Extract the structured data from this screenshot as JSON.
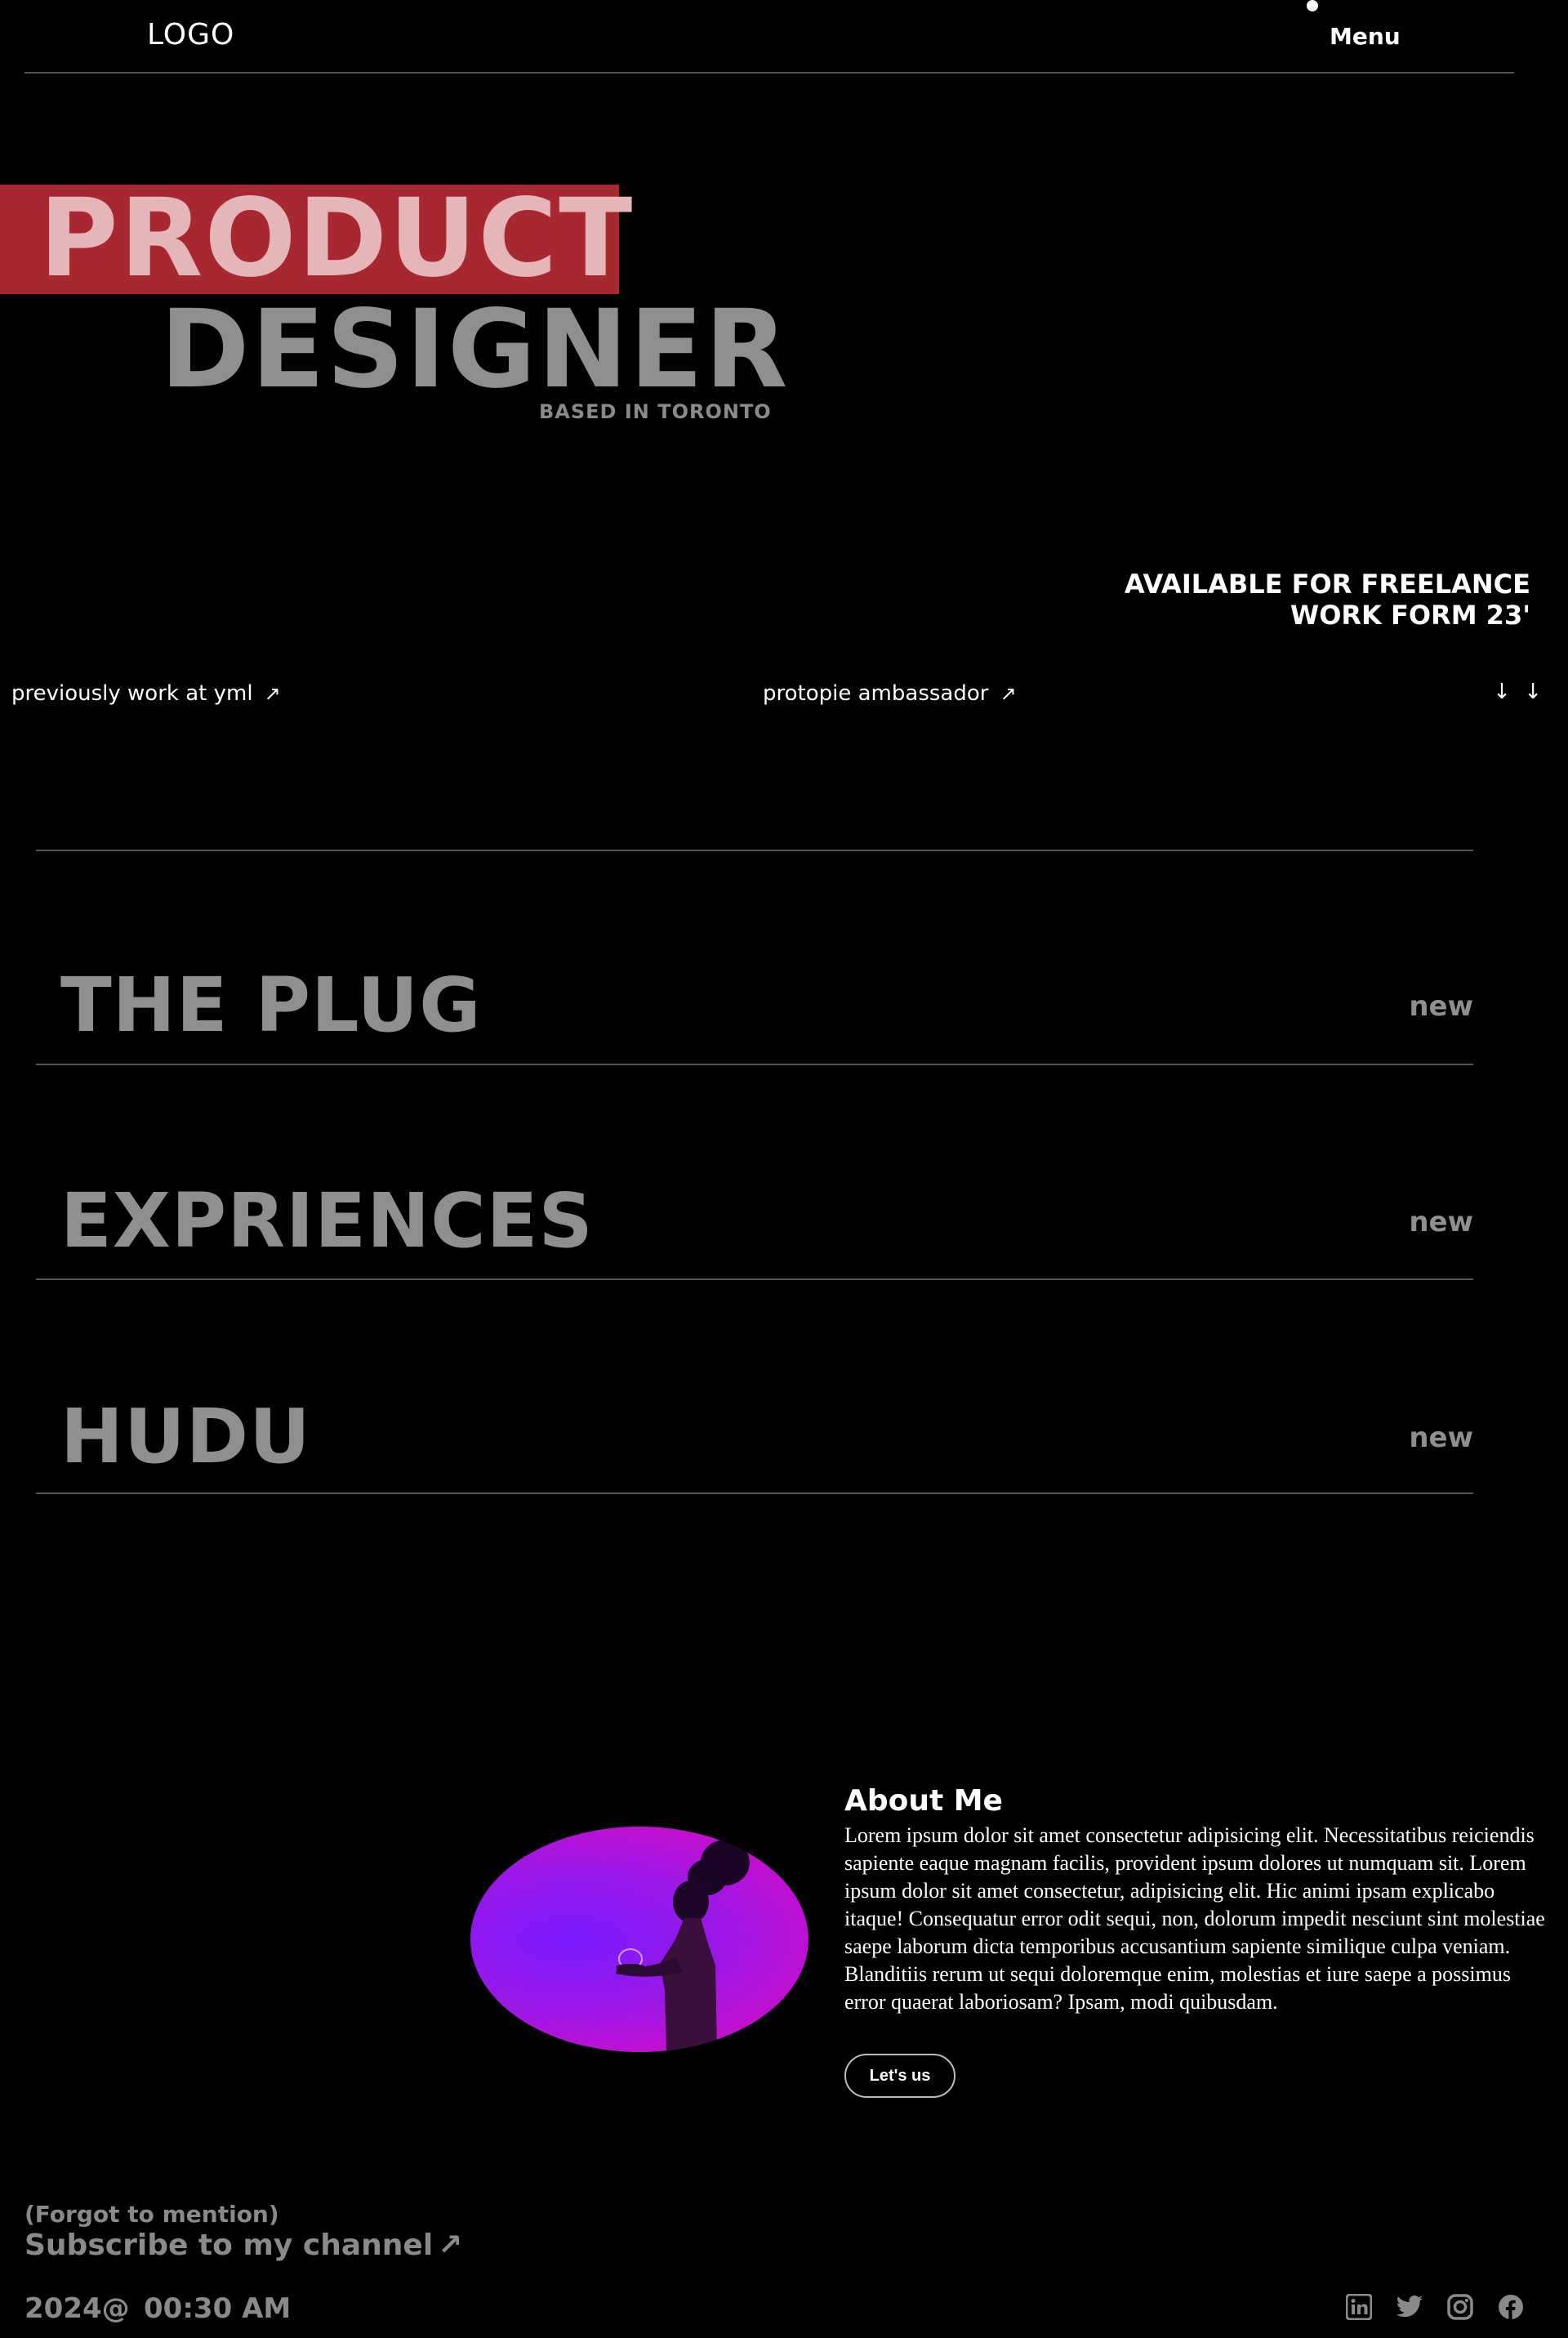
{
  "header": {
    "logo": "LOGO",
    "menu_label": "Menu"
  },
  "hero": {
    "line1": "PRODUCT",
    "line2": "DESIGNER",
    "location": "BASED IN TORONTO",
    "highlight_color": "#a8282f"
  },
  "availability": {
    "line1": "AVAILABLE FOR FREELANCE",
    "line2": "WORK FORM 23'"
  },
  "links": [
    {
      "label": "previously work at yml",
      "icon": "arrow-up-right-icon"
    },
    {
      "label": "protopie ambassador",
      "icon": "arrow-up-right-icon"
    }
  ],
  "scroll_hint": "↓ ↓",
  "projects": [
    {
      "title": "THE PLUG",
      "badge": "new"
    },
    {
      "title": "EXPRIENCES",
      "badge": "new"
    },
    {
      "title": "HUDU",
      "badge": "new"
    }
  ],
  "about": {
    "title": "About Me",
    "body": "Lorem ipsum dolor sit amet consectetur adipisicing elit. Necessitatibus reiciendis sapiente eaque magnam facilis, provident ipsum dolores ut numquam sit. Lorem ipsum dolor sit amet consectetur, adipisicing elit. Hic animi ipsam explicabo itaque! Consequatur error odit sequi, non, dolorum impedit nesciunt sint molestiae saepe laborum dicta temporibus accusantium sapiente similique culpa veniam. Blanditiis rerum ut sequi doloremque enim, molestias et iure saepe a possimus error quaerat laboriosam? Ipsam, modi quibusdam.",
    "button_label": "Let's us",
    "image_icon": "portrait-silhouette"
  },
  "footer": {
    "forgot": "(Forgot to mention)",
    "subscribe": "Subscribe to my channel",
    "year": "2024@",
    "time": "00:30 AM",
    "socials": [
      "linkedin-icon",
      "twitter-icon",
      "instagram-icon",
      "facebook-icon"
    ]
  }
}
